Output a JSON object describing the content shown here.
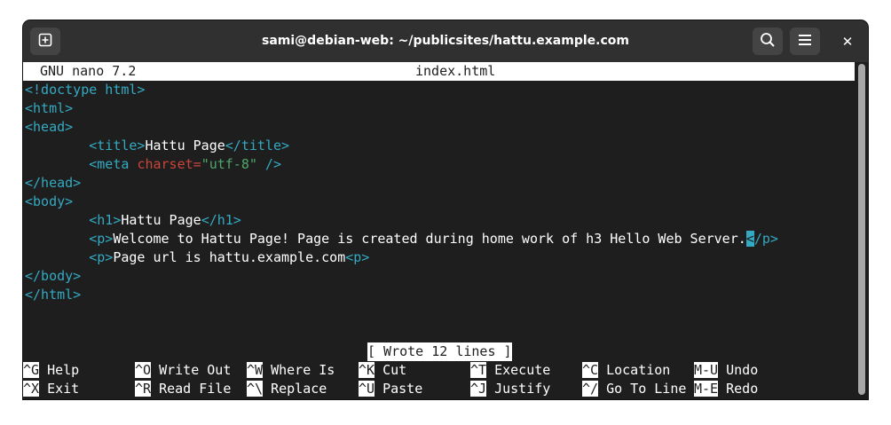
{
  "window": {
    "title": "sami@debian-web: ~/publicsites/hattu.example.com"
  },
  "icons": {
    "new_tab": "new-tab-icon",
    "search": "search-icon",
    "menu": "hamburger-menu-icon",
    "close": "close-icon",
    "close_glyph": "✕"
  },
  "nano": {
    "version": "GNU nano 7.2",
    "filename": "index.html",
    "status": "[ Wrote 12 lines ]"
  },
  "code": {
    "l1": "<!doctype html>",
    "l2": "<html>",
    "l3": "<head>",
    "l4_indent": "        ",
    "l4_open": "<title>",
    "l4_text": "Hattu Page",
    "l4_close": "</title>",
    "l5_indent": "        ",
    "l5_tag": "<meta ",
    "l5_attr": "charset=",
    "l5_str": "\"utf-8\"",
    "l5_end": " />",
    "l6": "</head>",
    "l7": "<body>",
    "l8_indent": "        ",
    "l8_open": "<h1>",
    "l8_text": "Hattu Page",
    "l8_close": "</h1>",
    "l9_indent": "        ",
    "l9_open": "<p>",
    "l9_text": "Welcome to Hattu Page! Page is created during home work of h3 Hello Web Server.",
    "l9_cursor": "<",
    "l9_close": "/p>",
    "l10_indent": "        ",
    "l10_open": "<p>",
    "l10_text": "Page url is hattu.example.com",
    "l10_close": "<p>",
    "l11": "</body>",
    "l12": "</html>"
  },
  "shortcuts": {
    "row1": [
      {
        "key": "^G",
        "label": "Help"
      },
      {
        "key": "^O",
        "label": "Write Out"
      },
      {
        "key": "^W",
        "label": "Where Is"
      },
      {
        "key": "^K",
        "label": "Cut"
      },
      {
        "key": "^T",
        "label": "Execute"
      },
      {
        "key": "^C",
        "label": "Location"
      },
      {
        "key": "M-U",
        "label": "Undo"
      }
    ],
    "row2": [
      {
        "key": "^X",
        "label": "Exit"
      },
      {
        "key": "^R",
        "label": "Read File"
      },
      {
        "key": "^\\",
        "label": "Replace"
      },
      {
        "key": "^U",
        "label": "Paste"
      },
      {
        "key": "^J",
        "label": "Justify"
      },
      {
        "key": "^/",
        "label": "Go To Line"
      },
      {
        "key": "M-E",
        "label": "Redo"
      }
    ]
  },
  "colors": {
    "tag": "#33aac2",
    "attribute": "#c9453a",
    "string": "#4fa86a",
    "background": "#1e1e1e",
    "titlebar": "#303030"
  }
}
